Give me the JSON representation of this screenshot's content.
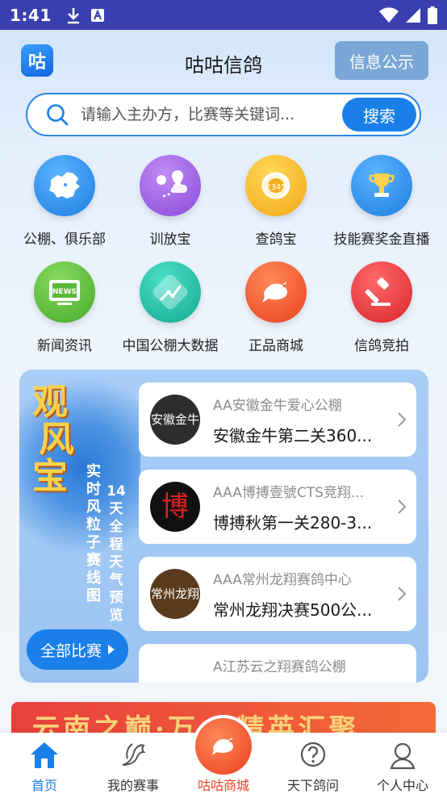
{
  "status_bar": {
    "time": "1:41"
  },
  "header": {
    "logo_text": "咕",
    "title": "咕咕信鸽",
    "info_button": "信息公示"
  },
  "search": {
    "placeholder": "请输入主办方，比赛等关键词...",
    "button": "搜索"
  },
  "grid": {
    "items": [
      {
        "label": "公棚、俱乐部",
        "icon": "china-map-icon",
        "color": "#2e8ee8"
      },
      {
        "label": "训放宝",
        "icon": "route-pin-icon",
        "color": "#9a5de0"
      },
      {
        "label": "查鸽宝",
        "icon": "leg-ring-icon",
        "color": "#f5b21e"
      },
      {
        "label": "技能赛奖金直播",
        "icon": "trophy-icon",
        "color": "#2e8ee8"
      },
      {
        "label": "新闻资讯",
        "icon": "news-tv-icon",
        "color": "#5cbf3a"
      },
      {
        "label": "中国公棚大数据",
        "icon": "data-chart-icon",
        "color": "#22bfa8"
      },
      {
        "label": "正品商城",
        "icon": "pigeon-icon",
        "color": "#f05a2e"
      },
      {
        "label": "信鸽竞拍",
        "icon": "auction-hammer-icon",
        "color": "#e8353a"
      }
    ]
  },
  "promo": {
    "big_chars": [
      "观",
      "风",
      "宝"
    ],
    "line1": "实时风粒子赛线图",
    "line2": "14天全程天气预览",
    "all_button": "全部比赛"
  },
  "matches": [
    {
      "club": "AA安徽金牛爱心公棚",
      "title": "安徽金牛第二关360...",
      "avatar_text": "安徽金牛",
      "avatar_color": "#2d2d2d"
    },
    {
      "club": "AAA博搏壹號CTS竞翔...",
      "title": "博搏秋第一关280-3...",
      "avatar_text": "博",
      "avatar_color": "#111111"
    },
    {
      "club": "AAA常州龙翔赛鸽中心",
      "title": "常州龙翔决赛500公...",
      "avatar_text": "常州龙翔",
      "avatar_color": "#5a3b1e"
    },
    {
      "club": "A江苏云之翔赛鸽公棚",
      "title": "",
      "avatar_text": "",
      "avatar_color": "#ffffff"
    }
  ],
  "banner": {
    "text": "云南之巅·万..·精英汇聚"
  },
  "tabs": [
    {
      "label": "首页",
      "icon": "home-icon",
      "active": true
    },
    {
      "label": "我的赛事",
      "icon": "dove-icon",
      "active": false
    },
    {
      "label": "咕咕商城",
      "icon": "pigeon-icon",
      "active": false
    },
    {
      "label": "天下鸽问",
      "icon": "question-icon",
      "active": false
    },
    {
      "label": "个人中心",
      "icon": "user-icon",
      "active": false
    }
  ],
  "colors": {
    "status_bar": "#3a3fb0",
    "accent": "#1a7fe8",
    "mall_tab_label": "#e8401f"
  }
}
